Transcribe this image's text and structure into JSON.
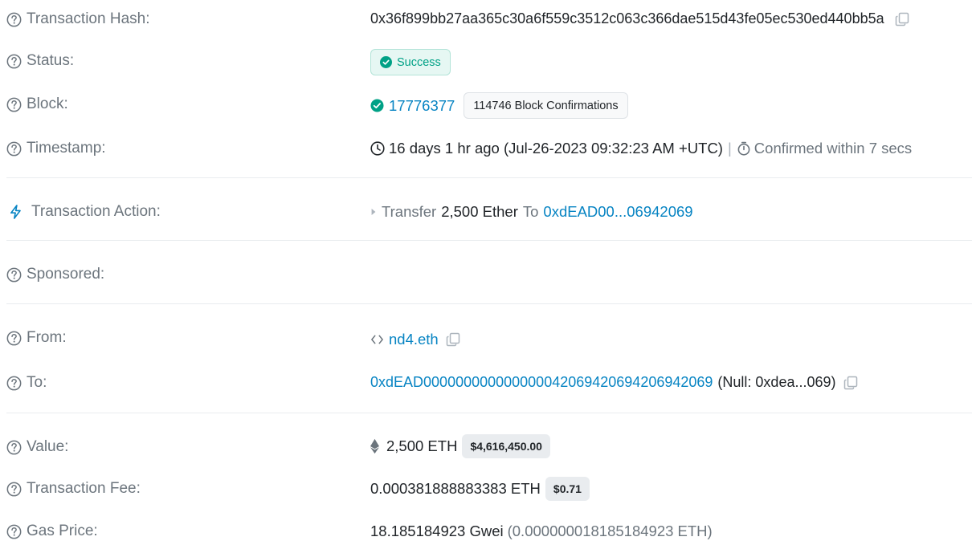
{
  "labels": {
    "tx_hash": "Transaction Hash:",
    "status": "Status:",
    "block": "Block:",
    "timestamp": "Timestamp:",
    "tx_action": "Transaction Action:",
    "sponsored": "Sponsored:",
    "from": "From:",
    "to": "To:",
    "value": "Value:",
    "tx_fee": "Transaction Fee:",
    "gas_price": "Gas Price:"
  },
  "tx_hash": "0x36f899bb27aa365c30a6f559c3512c063c366dae515d43fe05ec530ed440bb5a",
  "status": {
    "text": "Success",
    "color": "#00a186"
  },
  "block": {
    "number": "17776377",
    "confirmations": "114746 Block Confirmations"
  },
  "timestamp": {
    "text": "16 days 1 hr ago (Jul-26-2023 09:32:23 AM +UTC)",
    "separator": "|",
    "confirmed": "Confirmed within 7 secs"
  },
  "action": {
    "verb": "Transfer",
    "amount": "2,500 Ether",
    "to_word": "To",
    "to_address": "0xdEAD00...06942069"
  },
  "from": {
    "name": "nd4.eth"
  },
  "to": {
    "address": "0xdEAD000000000000000042069420694206942069",
    "note": "(Null: 0xdea...069)"
  },
  "value": {
    "amount": "2,500 ETH",
    "usd": "$4,616,450.00"
  },
  "fee": {
    "amount": "0.000381888883383 ETH",
    "usd": "$0.71"
  },
  "gas": {
    "gwei": "18.185184923 Gwei",
    "eth": "(0.000000018185184923 ETH)"
  },
  "colors": {
    "link": "#0784c3",
    "label": "#6c757d",
    "success": "#00a186"
  },
  "icons": {
    "help": "question-circle-icon",
    "copy": "copy-icon",
    "check": "check-circle-icon",
    "clock": "clock-icon",
    "stopwatch": "stopwatch-icon",
    "lightning": "lightning-icon",
    "caret": "caret-right-icon",
    "ens": "ens-code-icon",
    "eth": "ethereum-icon"
  }
}
